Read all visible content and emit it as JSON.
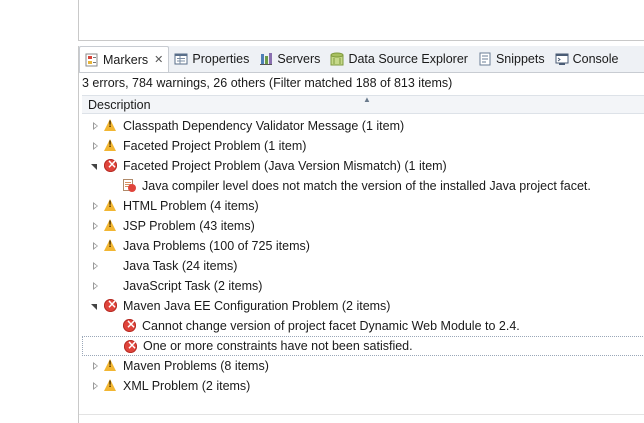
{
  "tabs": [
    {
      "label": "Markers",
      "icon": "markers-icon",
      "active": true,
      "closable": true
    },
    {
      "label": "Properties",
      "icon": "properties-icon",
      "active": false
    },
    {
      "label": "Servers",
      "icon": "servers-icon",
      "active": false
    },
    {
      "label": "Data Source Explorer",
      "icon": "data-source-explorer-icon",
      "active": false
    },
    {
      "label": "Snippets",
      "icon": "snippets-icon",
      "active": false
    },
    {
      "label": "Console",
      "icon": "console-icon",
      "active": false
    }
  ],
  "close_glyph": "✕",
  "summary": "3 errors, 784 warnings, 26 others (Filter matched 188 of 813 items)",
  "columns": {
    "description": "Description"
  },
  "rows": [
    {
      "label": "Classpath Dependency Validator Message (1 item)",
      "level": 0,
      "twisty": "collapsed",
      "severity": "warning"
    },
    {
      "label": "Faceted Project Problem (1 item)",
      "level": 0,
      "twisty": "collapsed",
      "severity": "warning"
    },
    {
      "label": "Faceted Project Problem (Java Version Mismatch) (1 item)",
      "level": 0,
      "twisty": "expanded",
      "severity": "error"
    },
    {
      "label": "Java compiler level does not match the version of the installed Java project facet.",
      "level": 1,
      "twisty": "none",
      "severity": "file-error"
    },
    {
      "label": "HTML Problem (4 items)",
      "level": 0,
      "twisty": "collapsed",
      "severity": "warning"
    },
    {
      "label": "JSP Problem (43 items)",
      "level": 0,
      "twisty": "collapsed",
      "severity": "warning"
    },
    {
      "label": "Java Problems (100 of 725 items)",
      "level": 0,
      "twisty": "collapsed",
      "severity": "warning"
    },
    {
      "label": "Java Task (24 items)",
      "level": 0,
      "twisty": "collapsed",
      "severity": "none"
    },
    {
      "label": "JavaScript Task (2 items)",
      "level": 0,
      "twisty": "collapsed",
      "severity": "none"
    },
    {
      "label": "Maven Java EE Configuration Problem (2 items)",
      "level": 0,
      "twisty": "expanded",
      "severity": "error"
    },
    {
      "label": "Cannot change version of project facet Dynamic Web Module to 2.4.",
      "level": 1,
      "twisty": "none",
      "severity": "error"
    },
    {
      "label": "One or more constraints have not been satisfied.",
      "level": 1,
      "twisty": "none",
      "severity": "error",
      "selected": true
    },
    {
      "label": "Maven Problems (8 items)",
      "level": 0,
      "twisty": "collapsed",
      "severity": "warning"
    },
    {
      "label": "XML Problem (2 items)",
      "level": 0,
      "twisty": "collapsed",
      "severity": "warning"
    }
  ]
}
